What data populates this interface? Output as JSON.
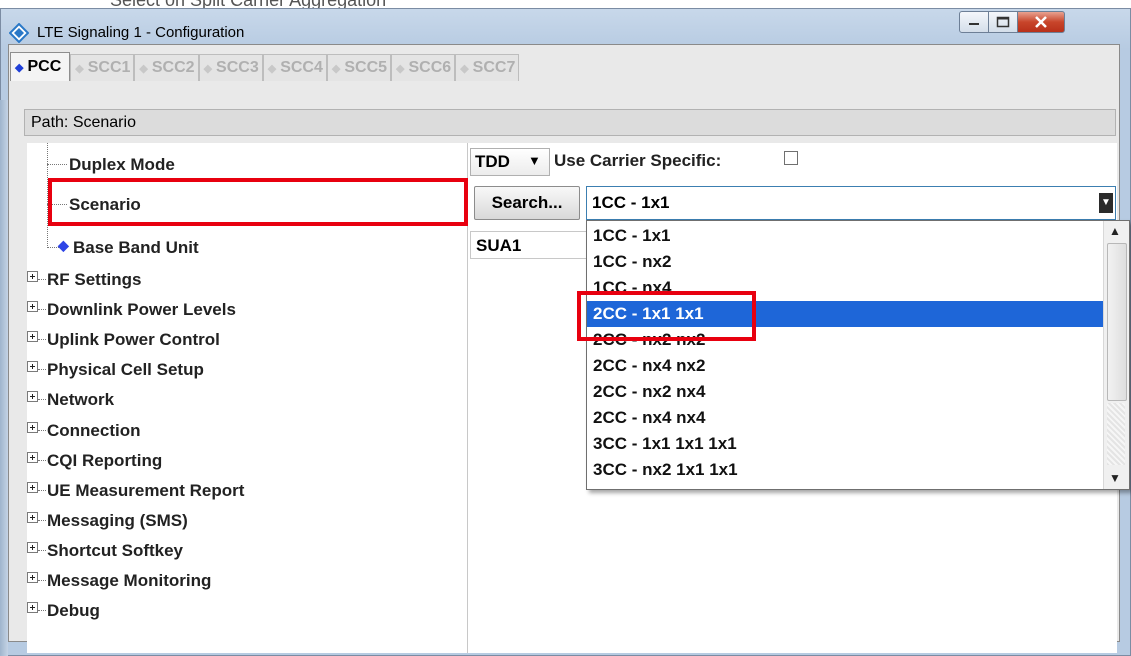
{
  "window": {
    "title": "LTE Signaling 1 - Configuration"
  },
  "top_fragment": "Select                     on Split Carrier Aggregation",
  "tabs": [
    {
      "label": "PCC",
      "active": true
    },
    {
      "label": "SCC1"
    },
    {
      "label": "SCC2"
    },
    {
      "label": "SCC3"
    },
    {
      "label": "SCC4"
    },
    {
      "label": "SCC5"
    },
    {
      "label": "SCC6"
    },
    {
      "label": "SCC7"
    }
  ],
  "path": {
    "label": "Path:",
    "value": "Scenario"
  },
  "tree": {
    "items": [
      {
        "label": "Duplex Mode"
      },
      {
        "label": "Scenario"
      },
      {
        "label": "Base Band Unit"
      },
      {
        "label": "RF Settings"
      },
      {
        "label": "Downlink Power Levels"
      },
      {
        "label": "Uplink Power Control"
      },
      {
        "label": "Physical Cell Setup"
      },
      {
        "label": "Network"
      },
      {
        "label": "Connection"
      },
      {
        "label": "CQI Reporting"
      },
      {
        "label": "UE Measurement Report"
      },
      {
        "label": "Messaging (SMS)"
      },
      {
        "label": "Shortcut Softkey"
      },
      {
        "label": "Message Monitoring"
      },
      {
        "label": "Debug"
      }
    ]
  },
  "editor": {
    "duplex_value": "TDD",
    "carrier_label": "Use Carrier Specific:",
    "carrier_checked": false,
    "search_label": "Search...",
    "scenario_value": "1CC - 1x1",
    "bbu_value": "SUA1"
  },
  "dropdown": {
    "options": [
      "1CC - 1x1",
      "1CC - nx2",
      "1CC - nx4",
      "2CC - 1x1 1x1",
      "2CC - nx2 nx2",
      "2CC - nx4 nx2",
      "2CC - nx2 nx4",
      "2CC - nx4 nx4",
      "3CC - 1x1 1x1 1x1",
      "3CC - nx2 1x1 1x1"
    ],
    "selected": "2CC - 1x1 1x1"
  },
  "colors": {
    "highlight": "#1e66d8",
    "annotation": "#e8000f",
    "active_tab_marker": "#1f3fd8"
  }
}
